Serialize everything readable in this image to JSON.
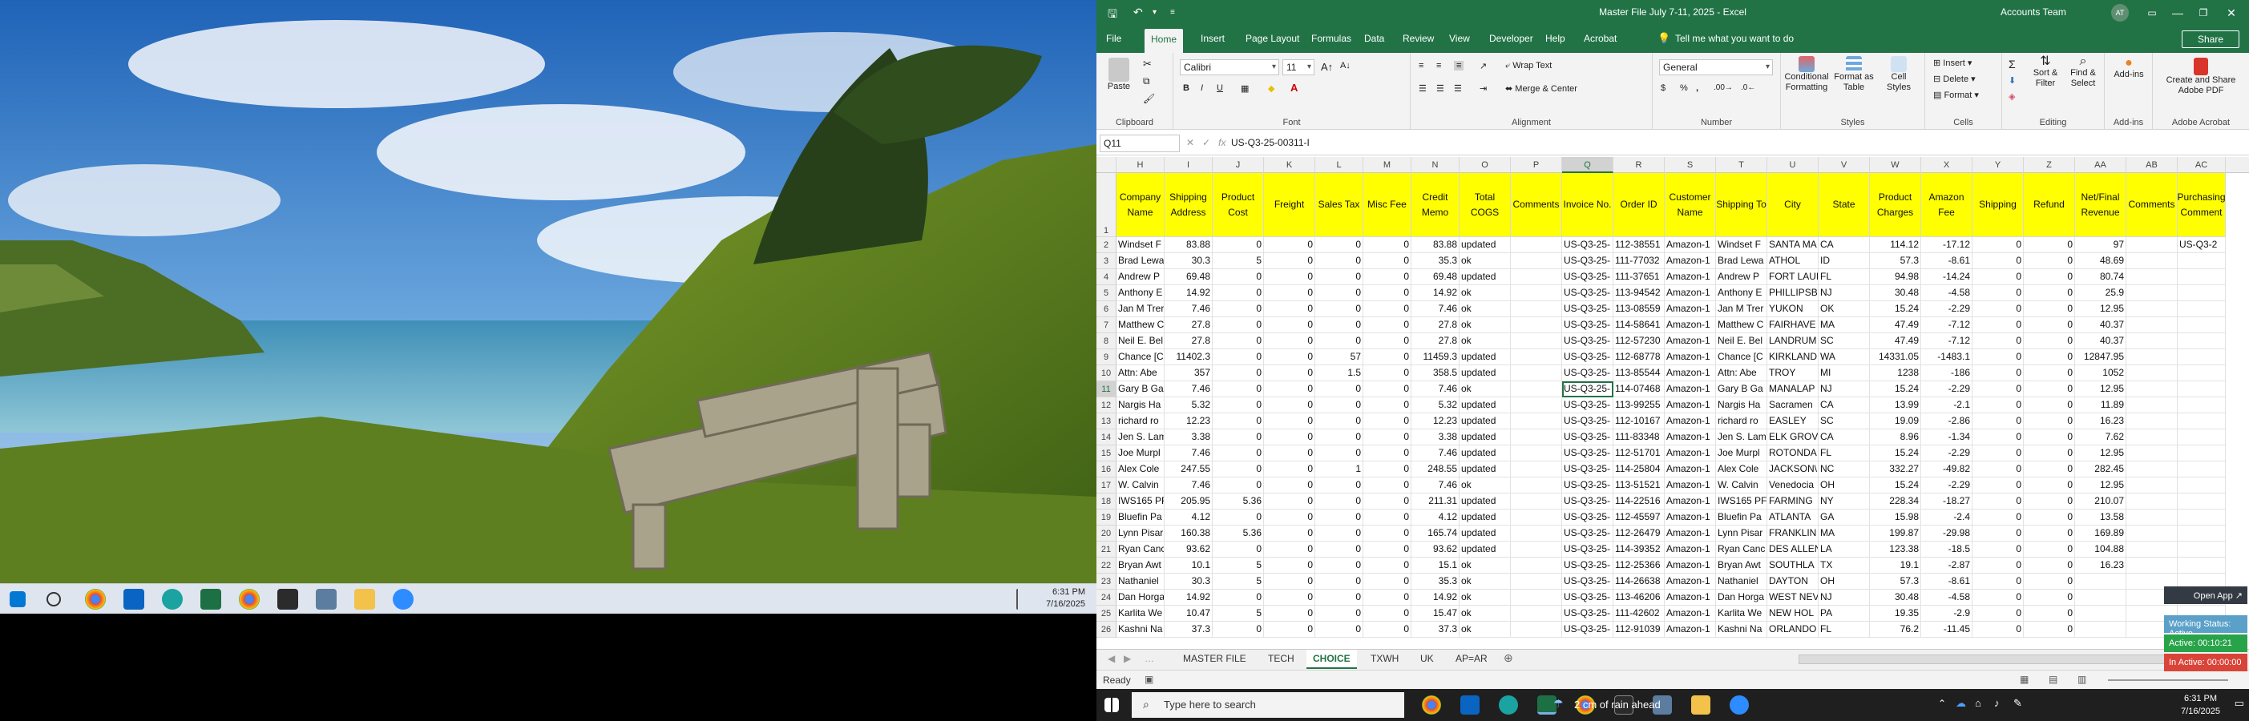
{
  "desktop": {
    "clock_time": "6:31 PM",
    "clock_date": "7/16/2025"
  },
  "excel": {
    "title": "Master File July 7-11, 2025  -  Excel",
    "account": "Accounts Team",
    "avatar_initials": "AT",
    "tabs": [
      "File",
      "Home",
      "Insert",
      "Page Layout",
      "Formulas",
      "Data",
      "Review",
      "View",
      "Developer",
      "Help",
      "Acrobat"
    ],
    "active_tab": "Home",
    "tell_me": "Tell me what you want to do",
    "share": "Share",
    "ribbon": {
      "clipboard": {
        "paste": "Paste",
        "label": "Clipboard"
      },
      "font": {
        "name": "Calibri",
        "size": "11",
        "label": "Font"
      },
      "alignment": {
        "wrap": "Wrap Text",
        "merge": "Merge & Center",
        "label": "Alignment"
      },
      "number": {
        "format": "General",
        "label": "Number"
      },
      "styles": {
        "conditional": "Conditional Formatting",
        "table": "Format as Table",
        "cell": "Cell Styles",
        "label": "Styles"
      },
      "cells": {
        "insert": "Insert",
        "delete": "Delete",
        "format": "Format",
        "label": "Cells"
      },
      "editing": {
        "sort": "Sort & Filter",
        "find": "Find & Select",
        "label": "Editing"
      },
      "addins": {
        "name": "Add-ins",
        "label": "Add-ins"
      },
      "acrobat": {
        "create": "Create and Share Adobe PDF",
        "label": "Adobe Acrobat"
      }
    },
    "name_box": "Q11",
    "formula": "US-Q3-25-00311-I",
    "columns": [
      "H",
      "I",
      "J",
      "K",
      "L",
      "M",
      "N",
      "O",
      "P",
      "Q",
      "R",
      "S",
      "T",
      "U",
      "V",
      "W",
      "X",
      "Y",
      "Z",
      "AA",
      "AB",
      "AC"
    ],
    "headers": [
      "Company Name",
      "Shipping Address",
      "Product Cost",
      "Freight",
      "Sales Tax",
      "Misc Fee",
      "Credit Memo",
      "Total COGS",
      "Comments",
      "Invoice No.",
      "Order ID",
      "Customer Name",
      "Shipping To",
      "City",
      "State",
      "Product Charges",
      "Amazon Fee",
      "Shipping",
      "Refund",
      "Net/Final Revenue",
      "Comments",
      "Purchasing Comment"
    ],
    "rows": [
      {
        "n": "2",
        "c": [
          "Windset F",
          "83.88",
          "0",
          "0",
          "0",
          "0",
          "83.88",
          "updated",
          "",
          "US-Q3-25-",
          "112-38551",
          "Amazon-1",
          "Windset F",
          "SANTA MA",
          "CA",
          "114.12",
          "-17.12",
          "0",
          "0",
          "97",
          "",
          "US-Q3-2"
        ]
      },
      {
        "n": "3",
        "c": [
          "Brad Lewa",
          "30.3",
          "5",
          "0",
          "0",
          "0",
          "35.3",
          "ok",
          "",
          "US-Q3-25-",
          "111-77032",
          "Amazon-1",
          "Brad Lewa",
          "ATHOL",
          "ID",
          "57.3",
          "-8.61",
          "0",
          "0",
          "48.69",
          "",
          ""
        ]
      },
      {
        "n": "4",
        "c": [
          "Andrew P",
          "69.48",
          "0",
          "0",
          "0",
          "0",
          "69.48",
          "updated",
          "",
          "US-Q3-25-",
          "111-37651",
          "Amazon-1",
          "Andrew P",
          "FORT LAUI",
          "FL",
          "94.98",
          "-14.24",
          "0",
          "0",
          "80.74",
          "",
          ""
        ]
      },
      {
        "n": "5",
        "c": [
          "Anthony E",
          "14.92",
          "0",
          "0",
          "0",
          "0",
          "14.92",
          "ok",
          "",
          "US-Q3-25-",
          "113-94542",
          "Amazon-1",
          "Anthony E",
          "PHILLIPSB",
          "NJ",
          "30.48",
          "-4.58",
          "0",
          "0",
          "25.9",
          "",
          ""
        ]
      },
      {
        "n": "6",
        "c": [
          "Jan M Trer",
          "7.46",
          "0",
          "0",
          "0",
          "0",
          "7.46",
          "ok",
          "",
          "US-Q3-25-",
          "113-08559",
          "Amazon-1",
          "Jan M Trer",
          "YUKON",
          "OK",
          "15.24",
          "-2.29",
          "0",
          "0",
          "12.95",
          "",
          ""
        ]
      },
      {
        "n": "7",
        "c": [
          "Matthew C",
          "27.8",
          "0",
          "0",
          "0",
          "0",
          "27.8",
          "ok",
          "",
          "US-Q3-25-",
          "114-58641",
          "Amazon-1",
          "Matthew C",
          "FAIRHAVE",
          "MA",
          "47.49",
          "-7.12",
          "0",
          "0",
          "40.37",
          "",
          ""
        ]
      },
      {
        "n": "8",
        "c": [
          "Neil E. Bel",
          "27.8",
          "0",
          "0",
          "0",
          "0",
          "27.8",
          "ok",
          "",
          "US-Q3-25-",
          "112-57230",
          "Amazon-1",
          "Neil E. Bel",
          "LANDRUM",
          "SC",
          "47.49",
          "-7.12",
          "0",
          "0",
          "40.37",
          "",
          ""
        ]
      },
      {
        "n": "9",
        "c": [
          "Chance [C",
          "11402.3",
          "0",
          "0",
          "57",
          "0",
          "11459.3",
          "updated",
          "",
          "US-Q3-25-",
          "112-68778",
          "Amazon-1",
          "Chance [C",
          "KIRKLAND",
          "WA",
          "14331.05",
          "-1483.1",
          "0",
          "0",
          "12847.95",
          "",
          ""
        ]
      },
      {
        "n": "10",
        "c": [
          "Attn: Abe",
          "357",
          "0",
          "0",
          "1.5",
          "0",
          "358.5",
          "updated",
          "",
          "US-Q3-25-",
          "113-85544",
          "Amazon-1",
          "Attn: Abe",
          "TROY",
          "MI",
          "1238",
          "-186",
          "0",
          "0",
          "1052",
          "",
          ""
        ]
      },
      {
        "n": "11",
        "c": [
          "Gary B Ga",
          "7.46",
          "0",
          "0",
          "0",
          "0",
          "7.46",
          "ok",
          "",
          "US-Q3-25-",
          "114-07468",
          "Amazon-1",
          "Gary B Ga",
          "MANALAP",
          "NJ",
          "15.24",
          "-2.29",
          "0",
          "0",
          "12.95",
          "",
          ""
        ]
      },
      {
        "n": "12",
        "c": [
          "Nargis Ha",
          "5.32",
          "0",
          "0",
          "0",
          "0",
          "5.32",
          "updated",
          "",
          "US-Q3-25-",
          "113-99255",
          "Amazon-1",
          "Nargis Ha",
          "Sacramen",
          "CA",
          "13.99",
          "-2.1",
          "0",
          "0",
          "11.89",
          "",
          ""
        ]
      },
      {
        "n": "13",
        "c": [
          "richard ro",
          "12.23",
          "0",
          "0",
          "0",
          "0",
          "12.23",
          "updated",
          "",
          "US-Q3-25-",
          "112-10167",
          "Amazon-1",
          "richard ro",
          "EASLEY",
          "SC",
          "19.09",
          "-2.86",
          "0",
          "0",
          "16.23",
          "",
          ""
        ]
      },
      {
        "n": "14",
        "c": [
          "Jen S. Lam",
          "3.38",
          "0",
          "0",
          "0",
          "0",
          "3.38",
          "updated",
          "",
          "US-Q3-25-",
          "111-83348",
          "Amazon-1",
          "Jen S. Lam",
          "ELK GROV",
          "CA",
          "8.96",
          "-1.34",
          "0",
          "0",
          "7.62",
          "",
          ""
        ]
      },
      {
        "n": "15",
        "c": [
          "Joe Murpl",
          "7.46",
          "0",
          "0",
          "0",
          "0",
          "7.46",
          "updated",
          "",
          "US-Q3-25-",
          "112-51701",
          "Amazon-1",
          "Joe Murpl",
          "ROTONDA",
          "FL",
          "15.24",
          "-2.29",
          "0",
          "0",
          "12.95",
          "",
          ""
        ]
      },
      {
        "n": "16",
        "c": [
          "Alex Cole",
          "247.55",
          "0",
          "0",
          "1",
          "0",
          "248.55",
          "updated",
          "",
          "US-Q3-25-",
          "114-25804",
          "Amazon-1",
          "Alex Cole",
          "JACKSON\\",
          "NC",
          "332.27",
          "-49.82",
          "0",
          "0",
          "282.45",
          "",
          ""
        ]
      },
      {
        "n": "17",
        "c": [
          "W. Calvin",
          "7.46",
          "0",
          "0",
          "0",
          "0",
          "7.46",
          "ok",
          "",
          "US-Q3-25-",
          "113-51521",
          "Amazon-1",
          "W. Calvin",
          "Venedocia",
          "OH",
          "15.24",
          "-2.29",
          "0",
          "0",
          "12.95",
          "",
          ""
        ]
      },
      {
        "n": "18",
        "c": [
          "IWS165 PF",
          "205.95",
          "5.36",
          "0",
          "0",
          "0",
          "211.31",
          "updated",
          "",
          "US-Q3-25-",
          "114-22516",
          "Amazon-1",
          "IWS165 PF",
          "FARMING",
          "NY",
          "228.34",
          "-18.27",
          "0",
          "0",
          "210.07",
          "",
          ""
        ]
      },
      {
        "n": "19",
        "c": [
          "Bluefin Pa",
          "4.12",
          "0",
          "0",
          "0",
          "0",
          "4.12",
          "updated",
          "",
          "US-Q3-25-",
          "112-45597",
          "Amazon-1",
          "Bluefin Pa",
          "ATLANTA",
          "GA",
          "15.98",
          "-2.4",
          "0",
          "0",
          "13.58",
          "",
          ""
        ]
      },
      {
        "n": "20",
        "c": [
          "Lynn Pisar",
          "160.38",
          "5.36",
          "0",
          "0",
          "0",
          "165.74",
          "updated",
          "",
          "US-Q3-25-",
          "112-26479",
          "Amazon-1",
          "Lynn Pisar",
          "FRANKLIN",
          "MA",
          "199.87",
          "-29.98",
          "0",
          "0",
          "169.89",
          "",
          ""
        ]
      },
      {
        "n": "21",
        "c": [
          "Ryan Canc",
          "93.62",
          "0",
          "0",
          "0",
          "0",
          "93.62",
          "updated",
          "",
          "US-Q3-25-",
          "114-39352",
          "Amazon-1",
          "Ryan Canc",
          "DES ALLEN",
          "LA",
          "123.38",
          "-18.5",
          "0",
          "0",
          "104.88",
          "",
          ""
        ]
      },
      {
        "n": "22",
        "c": [
          "Bryan Awt",
          "10.1",
          "5",
          "0",
          "0",
          "0",
          "15.1",
          "ok",
          "",
          "US-Q3-25-",
          "112-25366",
          "Amazon-1",
          "Bryan Awt",
          "SOUTHLA",
          "TX",
          "19.1",
          "-2.87",
          "0",
          "0",
          "16.23",
          "",
          ""
        ]
      },
      {
        "n": "23",
        "c": [
          "Nathaniel",
          "30.3",
          "5",
          "0",
          "0",
          "0",
          "35.3",
          "ok",
          "",
          "US-Q3-25-",
          "114-26638",
          "Amazon-1",
          "Nathaniel",
          "DAYTON",
          "OH",
          "57.3",
          "-8.61",
          "0",
          "0",
          "",
          "",
          ""
        ]
      },
      {
        "n": "24",
        "c": [
          "Dan Horga",
          "14.92",
          "0",
          "0",
          "0",
          "0",
          "14.92",
          "ok",
          "",
          "US-Q3-25-",
          "113-46206",
          "Amazon-1",
          "Dan Horga",
          "WEST NEV",
          "NJ",
          "30.48",
          "-4.58",
          "0",
          "0",
          "",
          "",
          ""
        ]
      },
      {
        "n": "25",
        "c": [
          "Karlita We",
          "10.47",
          "5",
          "0",
          "0",
          "0",
          "15.47",
          "ok",
          "",
          "US-Q3-25-",
          "111-42602",
          "Amazon-1",
          "Karlita We",
          "NEW HOL",
          "PA",
          "19.35",
          "-2.9",
          "0",
          "0",
          "",
          "",
          ""
        ]
      },
      {
        "n": "26",
        "c": [
          "Kashni Na",
          "37.3",
          "0",
          "0",
          "0",
          "0",
          "37.3",
          "ok",
          "",
          "US-Q3-25-",
          "112-91039",
          "Amazon-1",
          "Kashni Na",
          "ORLANDO",
          "FL",
          "76.2",
          "-11.45",
          "0",
          "0",
          "",
          "",
          ""
        ]
      }
    ],
    "selected_row": "11",
    "selected_col": "Q",
    "sheets": [
      "MASTER FILE",
      "TECH",
      "CHOICE",
      "TXWH",
      "UK",
      "AP=AR"
    ],
    "active_sheet": "CHOICE",
    "status": "Ready",
    "widget": {
      "open_app": "Open App ↗",
      "working_status": "Working Status: Active",
      "active": "Active: 00:10:21",
      "inactive": "In Active: 00:00:00"
    }
  },
  "taskbar": {
    "search_placeholder": "Type here to search",
    "weather": "2 cm of rain ahead",
    "clock_time": "6:31 PM",
    "clock_date": "7/16/2025"
  },
  "colors": {
    "excel_green": "#217346",
    "header_yellow": "#ffff00"
  }
}
